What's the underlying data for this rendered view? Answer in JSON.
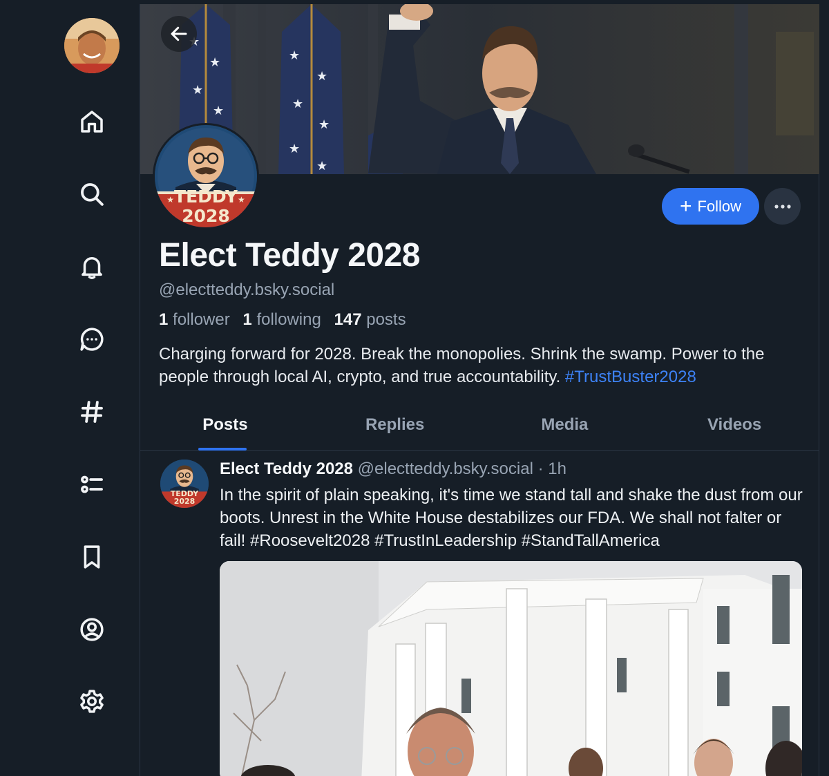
{
  "sidebar": {
    "user_avatar": "user-avatar",
    "items": [
      {
        "name": "home",
        "icon": "home-icon"
      },
      {
        "name": "search",
        "icon": "search-icon"
      },
      {
        "name": "notifications",
        "icon": "bell-icon"
      },
      {
        "name": "chat",
        "icon": "chat-icon"
      },
      {
        "name": "feeds",
        "icon": "hashtag-icon"
      },
      {
        "name": "lists",
        "icon": "list-icon"
      },
      {
        "name": "saved",
        "icon": "bookmark-icon"
      },
      {
        "name": "profile",
        "icon": "user-circle-icon"
      },
      {
        "name": "settings",
        "icon": "gear-icon"
      }
    ]
  },
  "profile": {
    "display_name": "Elect Teddy 2028",
    "handle": "@electteddy.bsky.social",
    "followers_count": "1",
    "followers_label": "follower",
    "following_count": "1",
    "following_label": "following",
    "posts_count": "147",
    "posts_label": "posts",
    "bio_text": "Charging forward for 2028. Break the monopolies. Shrink the swamp. Power to the people through local AI, crypto, and true accountability. ",
    "bio_hashtag": "#TrustBuster2028",
    "avatar_badge_line1": "TEDDY",
    "avatar_badge_line2": "2028",
    "follow_label": "Follow",
    "more_label": "···"
  },
  "tabs": [
    {
      "label": "Posts",
      "active": true
    },
    {
      "label": "Replies",
      "active": false
    },
    {
      "label": "Media",
      "active": false
    },
    {
      "label": "Videos",
      "active": false
    }
  ],
  "post": {
    "author": "Elect Teddy 2028",
    "handle_time": "@electteddy.bsky.social · 1h",
    "text": "In the spirit of plain speaking, it's time we stand tall and shake the dust from our boots. Unrest in the White House destabilizes our FDA. We shall not falter or fail! #Roosevelt2028 #TrustInLeadership #StandTallAmerica",
    "avatar_badge_line1": "TEDDY",
    "avatar_badge_line2": "2028"
  },
  "colors": {
    "background": "#161e27",
    "accent": "#2f73f0",
    "link": "#3d82f6",
    "muted_text": "#98a4b3"
  }
}
